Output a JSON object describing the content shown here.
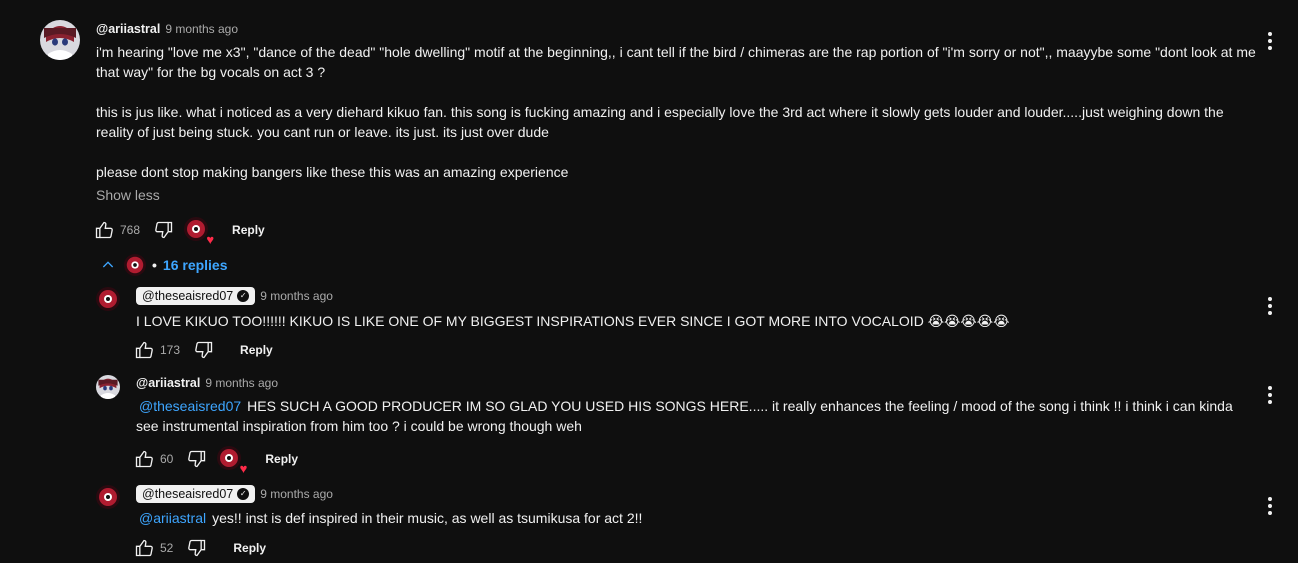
{
  "colors": {
    "background": "#0f0f0f",
    "text": "#f1f1f1",
    "muted": "#aaaaaa",
    "link": "#3ea6ff",
    "heart": "#ff2b49"
  },
  "icons": {
    "like": "thumbs-up-icon",
    "dislike": "thumbs-down-icon",
    "menu": "three-dots-vertical-icon",
    "chevron": "chevron-up-icon",
    "verified": "verified-check-icon",
    "heart": "creator-heart-icon"
  },
  "main_comment": {
    "author": "@ariiastral",
    "time": "9 months ago",
    "paragraphs": [
      "i'm hearing \"love me x3\", \"dance of the dead\" \"hole dwelling\" motif at the beginning,, i cant tell if the bird / chimeras are the rap portion of \"i'm sorry or not\",, maayybe some \"dont look at me that way\" for the bg vocals on act 3 ?",
      "this is jus like. what i noticed as a very diehard kikuo fan. this song is fucking amazing and i especially love the 3rd act where it slowly gets louder and louder.....just weighing down the reality of just being stuck. you cant run or leave. its just. its just over dude",
      "please dont stop making bangers like these this was an amazing experience"
    ],
    "show_less": "Show less",
    "likes": "768",
    "reply": "Reply",
    "replies_count": "16 replies",
    "replies_dot": "•"
  },
  "replies": [
    {
      "author": "@theseaisred07",
      "time": "9 months ago",
      "mention": "",
      "text": "I LOVE KIKUO TOO!!!!!! KIKUO IS LIKE ONE OF MY BIGGEST INSPIRATIONS EVER SINCE I GOT MORE INTO VOCALOID 😭😭😭😭😭",
      "likes": "173",
      "reply": "Reply"
    },
    {
      "author": "@ariiastral",
      "time": "9 months ago",
      "mention": "@theseaisred07",
      "text": "HES SUCH A GOOD PRODUCER IM SO GLAD YOU USED HIS SONGS HERE..... it really enhances the feeling / mood of the song i think !! i think i can kinda see instrumental inspiration from him too ? i could be wrong though weh",
      "likes": "60",
      "reply": "Reply"
    },
    {
      "author": "@theseaisred07",
      "time": "9 months ago",
      "mention": "@ariiastral",
      "text": "yes!! inst is def inspired in their music, as well as tsumikusa for act 2!!",
      "likes": "52",
      "reply": "Reply"
    }
  ]
}
